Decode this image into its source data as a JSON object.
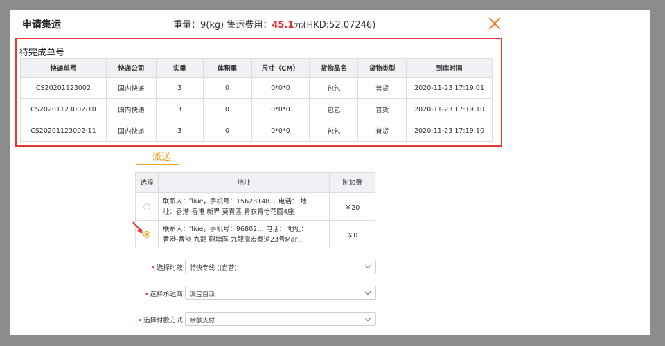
{
  "modal": {
    "title": "申请集运",
    "fee": {
      "weight_text": "重量：9(kg) 集运费用：",
      "amount": "45.1",
      "suffix": "元(HKD:52.07246)"
    }
  },
  "pending": {
    "title": "待完成单号",
    "columns": [
      "快递单号",
      "快递公司",
      "实重",
      "体积重",
      "尺寸（CM）",
      "货物品名",
      "货物类型",
      "到库时间"
    ],
    "rows": [
      [
        "CS20201123002",
        "国内快递",
        "3",
        "0",
        "0*0*0",
        "包包",
        "普货",
        "2020-11-23 17:19:01"
      ],
      [
        "CS20201123002-10",
        "国内快递",
        "3",
        "0",
        "0*0*0",
        "包包",
        "普货",
        "2020-11-23 17:19:10"
      ],
      [
        "CS20201123002-11",
        "国内快递",
        "3",
        "0",
        "0*0*0",
        "包包",
        "普货",
        "2020-11-23 17:19:10"
      ]
    ]
  },
  "delivery": {
    "tab_label": "派送",
    "columns": {
      "select": "选择",
      "address": "地址",
      "fee": "附加费"
    },
    "addresses": [
      {
        "line1": "联系人：fliue，手机号：15628148… 电话： 地",
        "line2": "址：香港-香港 新界 葵青區 青衣青怡花園4座",
        "fee": "￥20",
        "selected": false
      },
      {
        "line1": "联系人：fliue，手机号：96802… 电话： 地址：",
        "line2": "香港-香港 九龍 觀塘區 九龍灣宏泰道23号Mar…",
        "fee": "￥0",
        "selected": true
      }
    ]
  },
  "form": {
    "timeliness": {
      "label": "选择时效",
      "value": "特快专线-((自营)"
    },
    "carrier": {
      "label": "选择承运商",
      "value": "派宝自派"
    },
    "payment": {
      "label": "选择付款方式",
      "value": "余额支付"
    }
  },
  "colors": {
    "accent": "#f0a020",
    "highlight": "#e53935",
    "close": "#f0741e"
  }
}
